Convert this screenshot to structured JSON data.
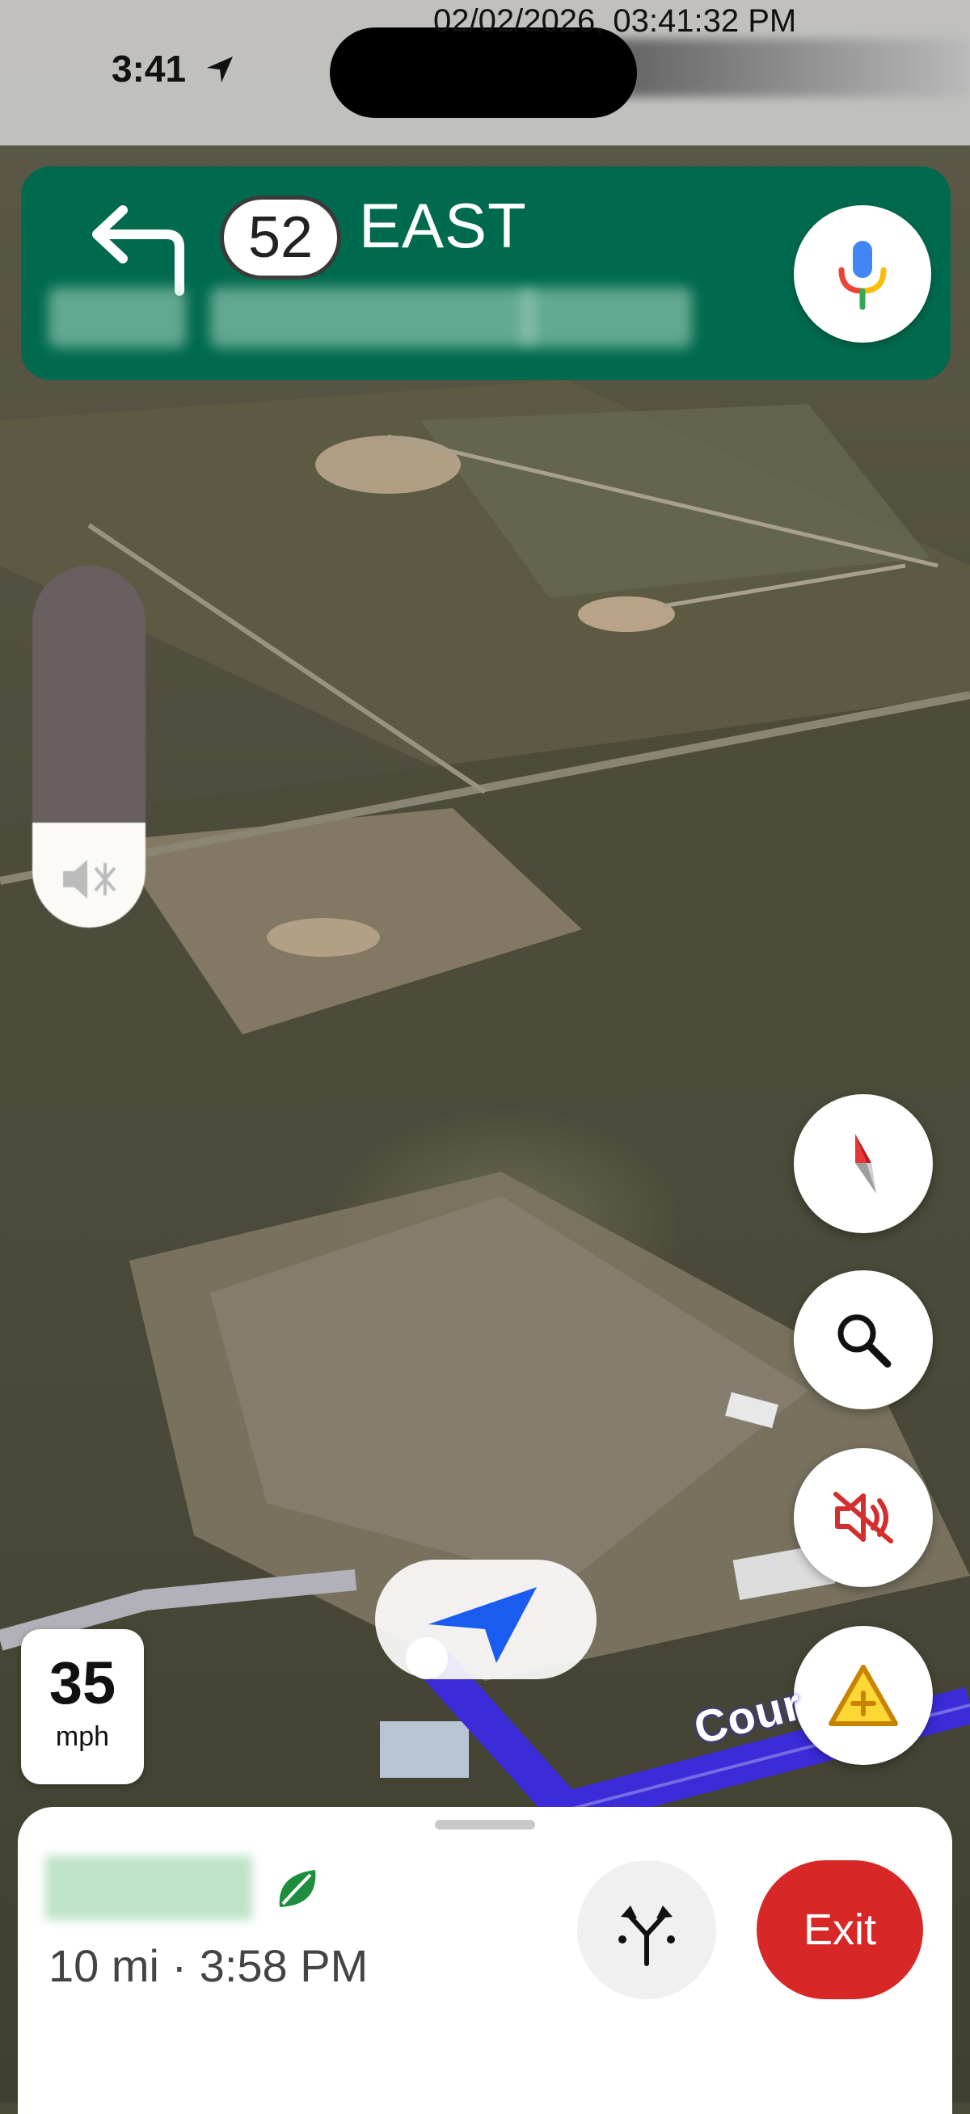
{
  "status_bar": {
    "time": "3:41",
    "timestamp": "02/02/2026, 03:41:32 PM"
  },
  "navigation": {
    "route_number": "52",
    "direction": "EAST"
  },
  "speed": {
    "value": "35",
    "unit": "mph"
  },
  "map": {
    "road_label": "Cour"
  },
  "trip": {
    "summary": "10 mi · 3:58 PM",
    "exit_label": "Exit"
  },
  "colors": {
    "nav_green": "#006a4e",
    "exit_red": "#d72727",
    "route_blue": "#3b2bd8"
  },
  "icons": [
    "turn-left-icon",
    "mic-icon",
    "volume-icon",
    "compass-icon",
    "search-icon",
    "mute-icon",
    "report-incident-icon",
    "eco-leaf-icon",
    "alternate-routes-icon",
    "location-arrow-icon"
  ]
}
